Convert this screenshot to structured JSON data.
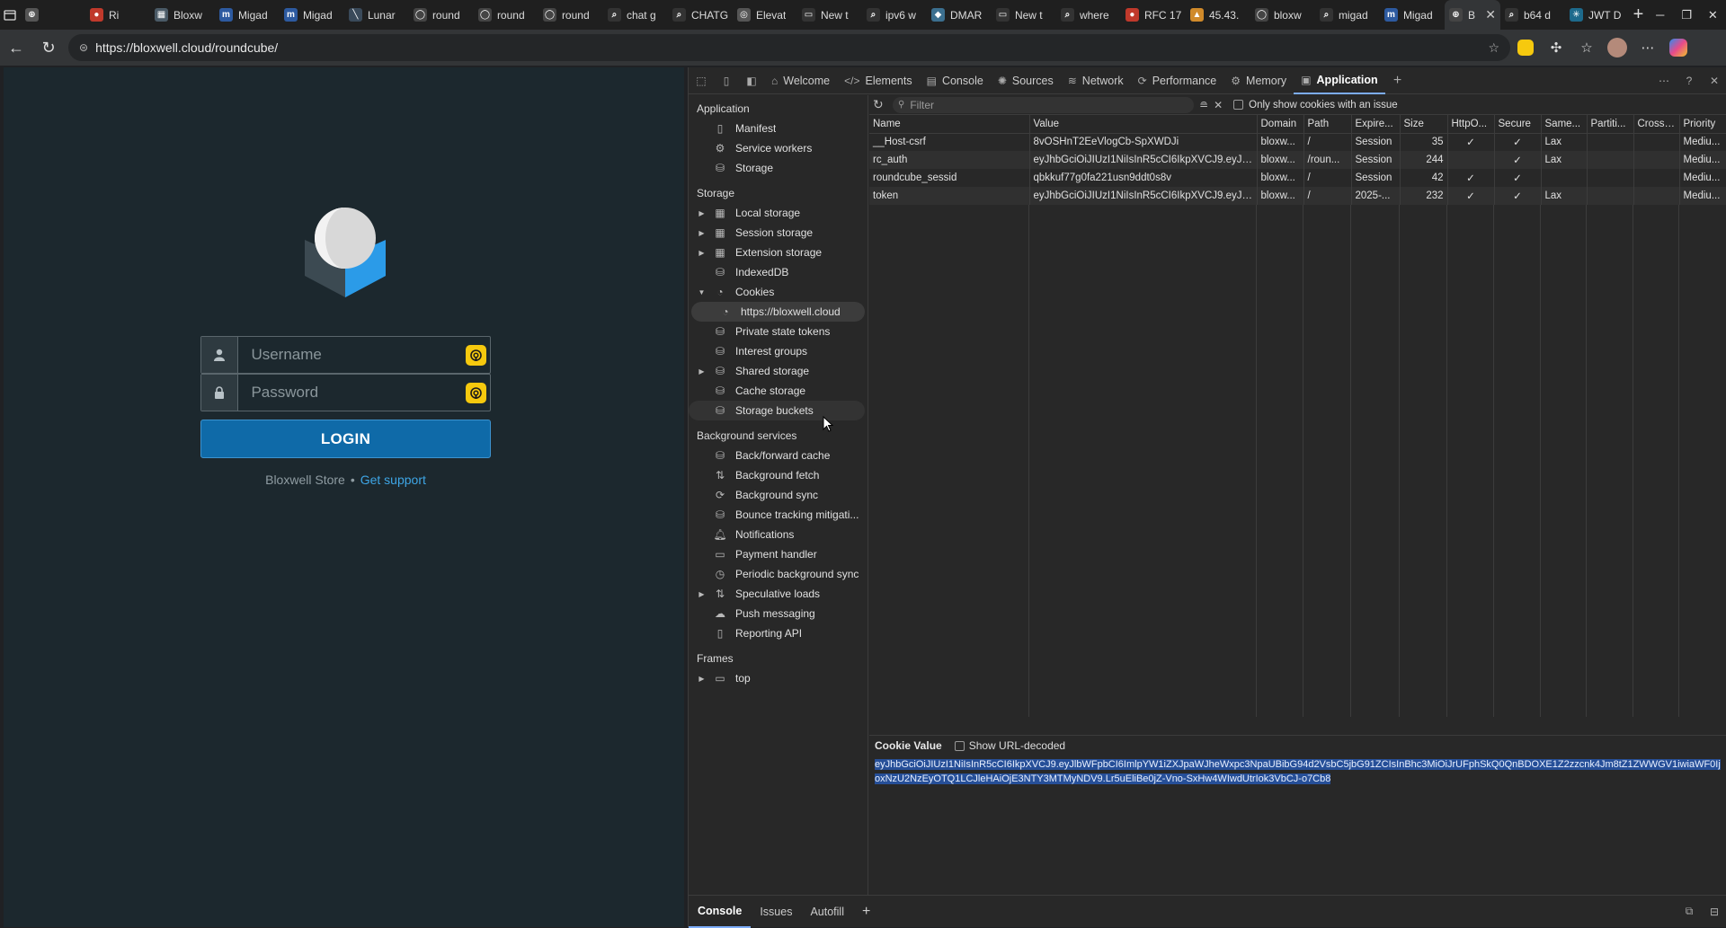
{
  "browser": {
    "tabs": [
      {
        "title": "",
        "fav": "⊕",
        "color": "#555"
      },
      {
        "title": "Ri",
        "fav": "●",
        "color": "#c0392b"
      },
      {
        "title": "Bloxw",
        "fav": "▦",
        "color": "#4a5a66"
      },
      {
        "title": "Migad",
        "fav": "m",
        "color": "#2d5aa0"
      },
      {
        "title": "Migad",
        "fav": "m",
        "color": "#2d5aa0"
      },
      {
        "title": "Lunar",
        "fav": "╲",
        "color": "#3a4a5a"
      },
      {
        "title": "round",
        "fav": "◯",
        "color": "#444"
      },
      {
        "title": "round",
        "fav": "◯",
        "color": "#444"
      },
      {
        "title": "round",
        "fav": "◯",
        "color": "#444"
      },
      {
        "title": "chat g",
        "fav": "⌕",
        "color": "#333"
      },
      {
        "title": "CHATG",
        "fav": "⌕",
        "color": "#333"
      },
      {
        "title": "Elevat",
        "fav": "◎",
        "color": "#555"
      },
      {
        "title": "New t",
        "fav": "▭",
        "color": "#333"
      },
      {
        "title": "ipv6 w",
        "fav": "⌕",
        "color": "#333"
      },
      {
        "title": "DMAR",
        "fav": "◆",
        "color": "#3b6f8f"
      },
      {
        "title": "New t",
        "fav": "▭",
        "color": "#333"
      },
      {
        "title": "where",
        "fav": "⌕",
        "color": "#333"
      },
      {
        "title": "RFC 17",
        "fav": "●",
        "color": "#c0392b"
      },
      {
        "title": "45.43.",
        "fav": "▲",
        "color": "#d08a2a"
      },
      {
        "title": "bloxw",
        "fav": "◯",
        "color": "#444"
      },
      {
        "title": "migad",
        "fav": "⌕",
        "color": "#333"
      },
      {
        "title": "Migad",
        "fav": "m",
        "color": "#2d5aa0"
      },
      {
        "title": "B",
        "fav": "⊕",
        "color": "#444",
        "active": true
      },
      {
        "title": "b64 d",
        "fav": "⌕",
        "color": "#333"
      },
      {
        "title": "JWT D",
        "fav": "✳",
        "color": "#1d6a8c"
      }
    ],
    "url": "https://bloxwell.cloud/roundcube/"
  },
  "login": {
    "username_placeholder": "Username",
    "password_placeholder": "Password",
    "login_label": "LOGIN",
    "footer_brand": "Bloxwell Store",
    "footer_sep": "•",
    "footer_link": "Get support"
  },
  "devtools": {
    "tabs": [
      "Welcome",
      "Elements",
      "Console",
      "Sources",
      "Network",
      "Performance",
      "Memory",
      "Application"
    ],
    "sidebar": {
      "application_heading": "Application",
      "application_items": [
        "Manifest",
        "Service workers",
        "Storage"
      ],
      "storage_heading": "Storage",
      "storage_items": [
        "Local storage",
        "Session storage",
        "Extension storage",
        "IndexedDB",
        "Cookies",
        "https://bloxwell.cloud",
        "Private state tokens",
        "Interest groups",
        "Shared storage",
        "Cache storage",
        "Storage buckets"
      ],
      "background_heading": "Background services",
      "background_items": [
        "Back/forward cache",
        "Background fetch",
        "Background sync",
        "Bounce tracking mitigati...",
        "Notifications",
        "Payment handler",
        "Periodic background sync",
        "Speculative loads",
        "Push messaging",
        "Reporting API"
      ],
      "frames_heading": "Frames",
      "frames_items": [
        "top"
      ]
    },
    "filter_placeholder": "Filter",
    "only_issues_label": "Only show cookies with an issue",
    "columns": [
      "Name",
      "Value",
      "Domain",
      "Path",
      "Expire...",
      "Size",
      "HttpO...",
      "Secure",
      "Same...",
      "Partiti...",
      "Cross ...",
      "Priority"
    ],
    "rows": [
      [
        "__Host-csrf",
        "8vOSHnT2EeVlogCb-SpXWDJi",
        "bloxw...",
        "/",
        "Session",
        "35",
        "✓",
        "✓",
        "Lax",
        "",
        "",
        "Mediu..."
      ],
      [
        "rc_auth",
        "eyJhbGciOiJIUzI1NiIsInR5cCI6IkpXVCJ9.eyJI...",
        "bloxw...",
        "/roun...",
        "Session",
        "244",
        "",
        "✓",
        "Lax",
        "",
        "",
        "Mediu..."
      ],
      [
        "roundcube_sessid",
        "qbkkuf77g0fa221usn9ddt0s8v",
        "bloxw...",
        "/",
        "Session",
        "42",
        "✓",
        "✓",
        "",
        "",
        "",
        "Mediu..."
      ],
      [
        "token",
        "eyJhbGciOiJIUzI1NiIsInR5cCI6IkpXVCJ9.eyJy...",
        "bloxw...",
        "/",
        "2025-...",
        "232",
        "✓",
        "✓",
        "Lax",
        "",
        "",
        "Mediu..."
      ]
    ],
    "cookie_value_heading": "Cookie Value",
    "show_url_decoded": "Show URL-decoded",
    "cookie_value": "eyJhbGciOiJIUzI1NiIsInR5cCI6IkpXVCJ9.eyJlbWFpbCI6ImlpYW1iZXJpaWJheWxpc3NpaUBibG94d2VsbC5jbG91ZCIsInBhc3MiOiJrUFphSkQ0QnBDOXE1Z2zzcnk4Jm8tZ1ZWWGV1iwiaWF0IjoxNzU2NzEyOTQ1LCJleHAiOjE3NTY3MTMyNDV9.Lr5uEliBe0jZ-Vno-SxHw4WIwdUtrIok3VbCJ-o7Cb8",
    "drawer_tabs": [
      "Console",
      "Issues",
      "Autofill"
    ]
  }
}
